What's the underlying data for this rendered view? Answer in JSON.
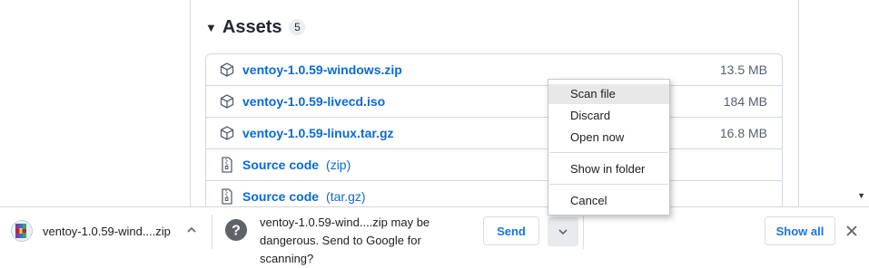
{
  "release": {
    "assets_title": "Assets",
    "assets_count": "5",
    "assets": [
      {
        "name": "ventoy-1.0.59-windows.zip",
        "suffix": "",
        "size": "13.5 MB",
        "icon": "package-icon"
      },
      {
        "name": "ventoy-1.0.59-livecd.iso",
        "suffix": "",
        "size": "184 MB",
        "icon": "package-icon"
      },
      {
        "name": "ventoy-1.0.59-linux.tar.gz",
        "suffix": "",
        "size": "16.8 MB",
        "icon": "package-icon"
      },
      {
        "name": "Source code",
        "suffix": "(zip)",
        "size": "",
        "icon": "file-zip-icon"
      },
      {
        "name": "Source code",
        "suffix": "(tar.gz)",
        "size": "",
        "icon": "file-zip-icon"
      }
    ]
  },
  "context_menu": {
    "items": [
      "Scan file",
      "Discard",
      "Open now",
      "Show in folder",
      "Cancel"
    ],
    "highlighted": "Scan file"
  },
  "download_shelf": {
    "file_name": "ventoy-1.0.59-wind....zip",
    "warning_line1": "ventoy-1.0.59-wind....zip may be",
    "warning_line2": "dangerous. Send to Google for scanning?",
    "send_label": "Send",
    "show_all_label": "Show all"
  },
  "colors": {
    "link": "#0969da",
    "chrome_blue": "#1a73e8",
    "border": "#d0d7de"
  }
}
